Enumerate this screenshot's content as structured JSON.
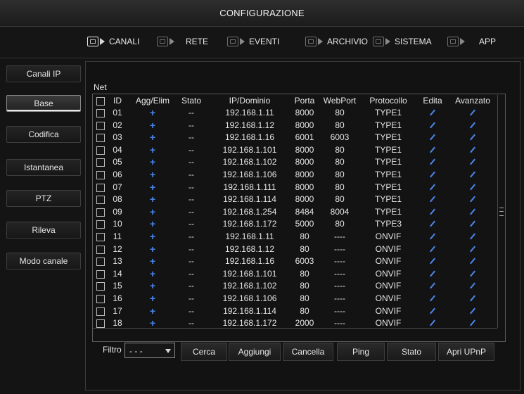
{
  "window": {
    "title": "CONFIGURAZIONE"
  },
  "tabs": [
    {
      "label": "CANALI",
      "icon": "camera-icon",
      "active": true
    },
    {
      "label": "RETE",
      "icon": "network-icon",
      "active": false
    },
    {
      "label": "EVENTI",
      "icon": "alarm-icon",
      "active": false
    },
    {
      "label": "ARCHIVIO",
      "icon": "storage-icon",
      "active": false
    },
    {
      "label": "SISTEMA",
      "icon": "system-icon",
      "active": false
    },
    {
      "label": "APP",
      "icon": "app-icon",
      "active": false
    }
  ],
  "sidebar": {
    "items": [
      {
        "label": "Canali IP"
      },
      {
        "label": "Base",
        "active": true
      },
      {
        "label": "Codifica"
      },
      {
        "label": "Istantanea"
      },
      {
        "label": "PTZ"
      },
      {
        "label": "Rileva"
      },
      {
        "label": "Modo canale"
      }
    ]
  },
  "main": {
    "section_label": "Net",
    "columns": [
      "ID",
      "Agg/Elim",
      "Stato",
      "IP/Dominio",
      "Porta",
      "WebPort",
      "Protocollo",
      "Edita",
      "Avanzato"
    ],
    "rows": [
      {
        "id": "01",
        "add": "+",
        "stato": "--",
        "ip": "192.168.1.11",
        "porta": "8000",
        "web": "80",
        "proto": "TYPE1"
      },
      {
        "id": "02",
        "add": "+",
        "stato": "--",
        "ip": "192.168.1.12",
        "porta": "8000",
        "web": "80",
        "proto": "TYPE1"
      },
      {
        "id": "03",
        "add": "+",
        "stato": "--",
        "ip": "192.168.1.16",
        "porta": "6001",
        "web": "6003",
        "proto": "TYPE1"
      },
      {
        "id": "04",
        "add": "+",
        "stato": "--",
        "ip": "192.168.1.101",
        "porta": "8000",
        "web": "80",
        "proto": "TYPE1"
      },
      {
        "id": "05",
        "add": "+",
        "stato": "--",
        "ip": "192.168.1.102",
        "porta": "8000",
        "web": "80",
        "proto": "TYPE1"
      },
      {
        "id": "06",
        "add": "+",
        "stato": "--",
        "ip": "192.168.1.106",
        "porta": "8000",
        "web": "80",
        "proto": "TYPE1"
      },
      {
        "id": "07",
        "add": "+",
        "stato": "--",
        "ip": "192.168.1.111",
        "porta": "8000",
        "web": "80",
        "proto": "TYPE1"
      },
      {
        "id": "08",
        "add": "+",
        "stato": "--",
        "ip": "192.168.1.114",
        "porta": "8000",
        "web": "80",
        "proto": "TYPE1"
      },
      {
        "id": "09",
        "add": "+",
        "stato": "--",
        "ip": "192.168.1.254",
        "porta": "8484",
        "web": "8004",
        "proto": "TYPE1"
      },
      {
        "id": "10",
        "add": "+",
        "stato": "--",
        "ip": "192.168.1.172",
        "porta": "5000",
        "web": "80",
        "proto": "TYPE3"
      },
      {
        "id": "11",
        "add": "+",
        "stato": "--",
        "ip": "192.168.1.11",
        "porta": "80",
        "web": "----",
        "proto": "ONVIF"
      },
      {
        "id": "12",
        "add": "+",
        "stato": "--",
        "ip": "192.168.1.12",
        "porta": "80",
        "web": "----",
        "proto": "ONVIF"
      },
      {
        "id": "13",
        "add": "+",
        "stato": "--",
        "ip": "192.168.1.16",
        "porta": "6003",
        "web": "----",
        "proto": "ONVIF"
      },
      {
        "id": "14",
        "add": "+",
        "stato": "--",
        "ip": "192.168.1.101",
        "porta": "80",
        "web": "----",
        "proto": "ONVIF"
      },
      {
        "id": "15",
        "add": "+",
        "stato": "--",
        "ip": "192.168.1.102",
        "porta": "80",
        "web": "----",
        "proto": "ONVIF"
      },
      {
        "id": "16",
        "add": "+",
        "stato": "--",
        "ip": "192.168.1.106",
        "porta": "80",
        "web": "----",
        "proto": "ONVIF"
      },
      {
        "id": "17",
        "add": "+",
        "stato": "--",
        "ip": "192.168.1.114",
        "porta": "80",
        "web": "----",
        "proto": "ONVIF"
      },
      {
        "id": "18",
        "add": "+",
        "stato": "--",
        "ip": "192.168.1.172",
        "porta": "2000",
        "web": "----",
        "proto": "ONVIF"
      }
    ]
  },
  "footer": {
    "filter_label": "Filtro",
    "filter_value": "- - -",
    "buttons": [
      "Cerca",
      "Aggiungi",
      "Cancella",
      "Ping",
      "Stato",
      "Apri UPnP"
    ]
  },
  "colors": {
    "accent": "#4a86e8",
    "background": "#141414",
    "text": "#e6e6e6"
  }
}
